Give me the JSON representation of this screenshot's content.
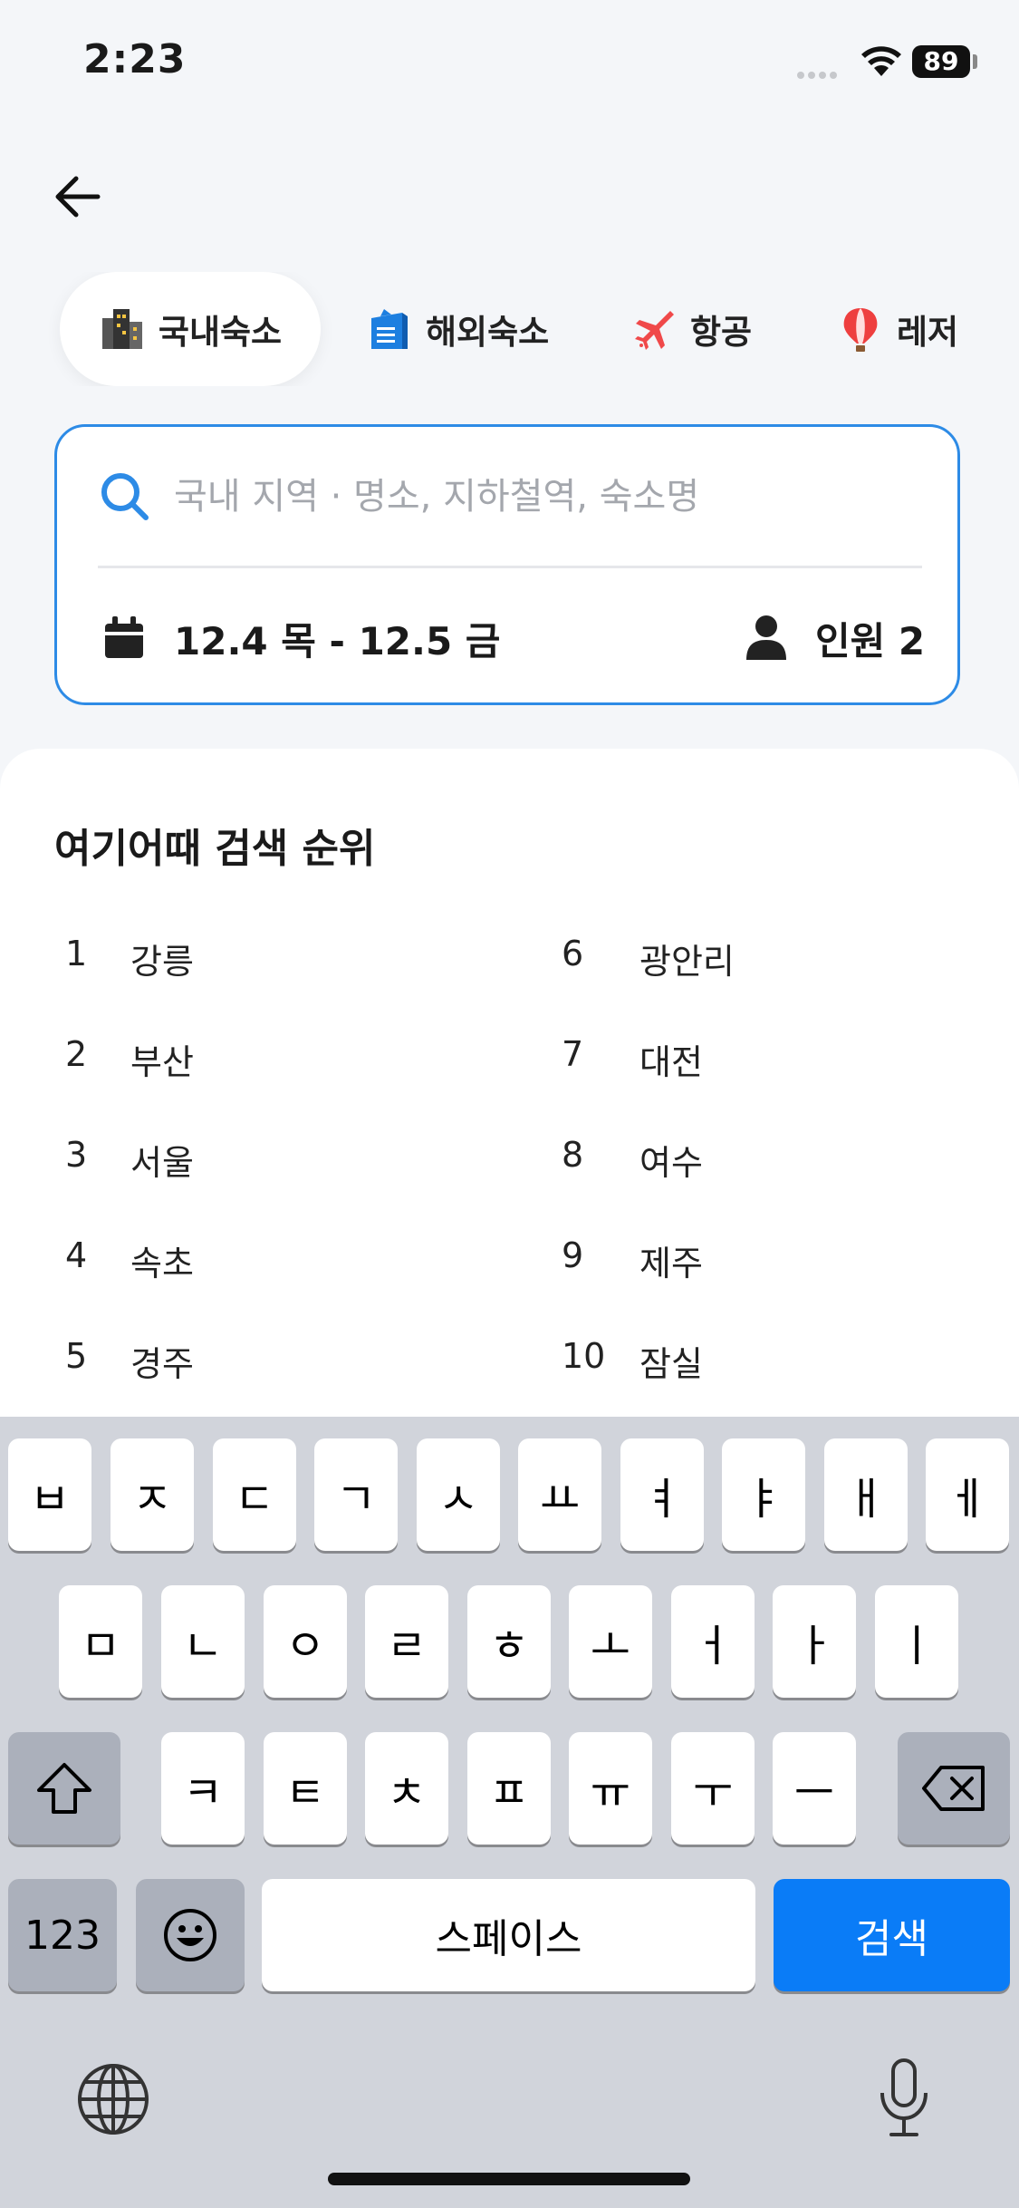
{
  "status_bar": {
    "time": "2:23",
    "battery": "89"
  },
  "tabs": [
    {
      "label": "국내숙소",
      "icon": "building-icon"
    },
    {
      "label": "해외숙소",
      "icon": "hotel-icon"
    },
    {
      "label": "항공",
      "icon": "airplane-icon"
    },
    {
      "label": "레저",
      "icon": "balloon-icon"
    }
  ],
  "search": {
    "placeholder": "국내 지역 · 명소, 지하철역, 숙소명",
    "value": "",
    "dates": "12.4 목 - 12.5 금",
    "guests": "인원 2"
  },
  "ranking": {
    "title": "여기어때 검색 순위",
    "items": [
      {
        "rank": "1",
        "name": "강릉"
      },
      {
        "rank": "2",
        "name": "부산"
      },
      {
        "rank": "3",
        "name": "서울"
      },
      {
        "rank": "4",
        "name": "속초"
      },
      {
        "rank": "5",
        "name": "경주"
      },
      {
        "rank": "6",
        "name": "광안리"
      },
      {
        "rank": "7",
        "name": "대전"
      },
      {
        "rank": "8",
        "name": "여수"
      },
      {
        "rank": "9",
        "name": "제주"
      },
      {
        "rank": "10",
        "name": "잠실"
      }
    ]
  },
  "keyboard": {
    "row1": [
      "ㅂ",
      "ㅈ",
      "ㄷ",
      "ㄱ",
      "ㅅ",
      "ㅛ",
      "ㅕ",
      "ㅑ",
      "ㅐ",
      "ㅔ"
    ],
    "row2": [
      "ㅁ",
      "ㄴ",
      "ㅇ",
      "ㄹ",
      "ㅎ",
      "ㅗ",
      "ㅓ",
      "ㅏ",
      "ㅣ"
    ],
    "row3": [
      "ㅋ",
      "ㅌ",
      "ㅊ",
      "ㅍ",
      "ㅠ",
      "ㅜ",
      "ㅡ"
    ],
    "numbers_label": "123",
    "space_label": "스페이스",
    "search_label": "검색"
  },
  "colors": {
    "accent": "#2d8be6",
    "search_key": "#0a7cf7"
  }
}
